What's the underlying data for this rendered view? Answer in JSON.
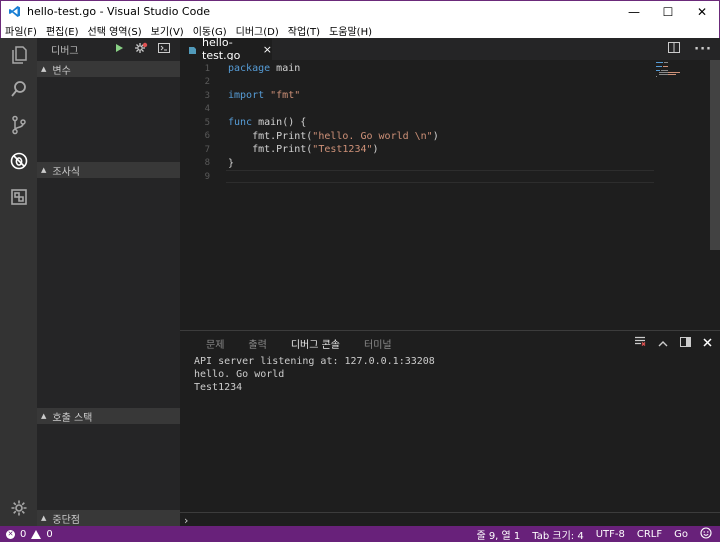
{
  "window": {
    "title": "hello-test.go - Visual Studio Code",
    "minimize": "—",
    "maximize": "☐",
    "close": "✕"
  },
  "menu": [
    "파일(F)",
    "편집(E)",
    "선택 영역(S)",
    "보기(V)",
    "이동(G)",
    "디버그(D)",
    "작업(T)",
    "도움말(H)"
  ],
  "sidebar": {
    "title": "디버그",
    "sections": {
      "variables": "변수",
      "watch": "조사식",
      "call_stack": "호출 스택",
      "breakpoints": "중단점"
    }
  },
  "editor": {
    "tab_label": "hello-test.go",
    "tab_close": "×",
    "line_numbers": [
      "1",
      "2",
      "3",
      "4",
      "5",
      "6",
      "7",
      "8",
      "9"
    ],
    "code": {
      "l1_kw": "package",
      "l1_rest": " main",
      "l3_kw": "import",
      "l3_str": " \"fmt\"",
      "l5_kw": "func",
      "l5_rest": " main() {",
      "l6_pre": "    fmt.Print(",
      "l6_str": "\"hello. Go world \\n\"",
      "l6_post": ")",
      "l7_pre": "    fmt.Print(",
      "l7_str": "\"Test1234\"",
      "l7_post": ")",
      "l8": "}"
    }
  },
  "panel": {
    "tabs": [
      "문제",
      "출력",
      "디버그 콘솔",
      "터미널"
    ],
    "active_tab": "디버그 콘솔",
    "output": [
      "API server listening at: 127.0.0.1:33208",
      "hello. Go world",
      "Test1234"
    ],
    "prompt": "›"
  },
  "statusbar": {
    "errors": "0",
    "warnings": "0",
    "position": "줄 9, 열 1",
    "tab_size": "Tab 크기: 4",
    "encoding": "UTF-8",
    "eol": "CRLF",
    "language": "Go"
  },
  "colors": {
    "status_bar": "#68217a",
    "keyword": "#569cd6",
    "string": "#ce9178",
    "debug_run": "#89d185"
  }
}
